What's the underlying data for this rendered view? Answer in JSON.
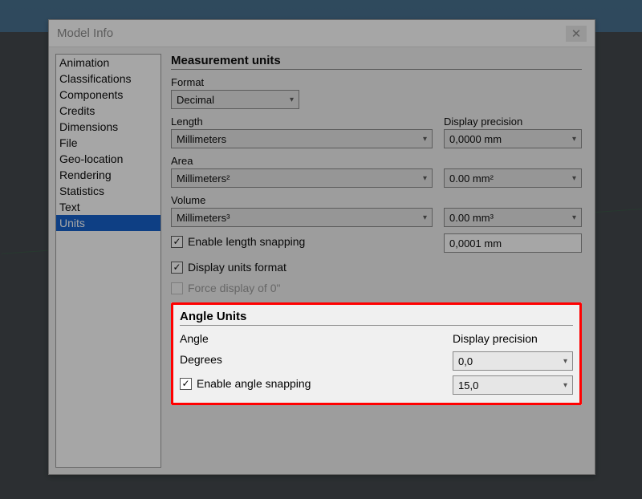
{
  "window": {
    "title": "Model Info",
    "close_icon": "✕"
  },
  "sidebar": {
    "items": [
      {
        "label": "Animation"
      },
      {
        "label": "Classifications"
      },
      {
        "label": "Components"
      },
      {
        "label": "Credits"
      },
      {
        "label": "Dimensions"
      },
      {
        "label": "File"
      },
      {
        "label": "Geo-location"
      },
      {
        "label": "Rendering"
      },
      {
        "label": "Statistics"
      },
      {
        "label": "Text"
      },
      {
        "label": "Units"
      }
    ],
    "selected_index": 10
  },
  "measurement": {
    "section_title": "Measurement units",
    "format_label": "Format",
    "format_value": "Decimal",
    "length_label": "Length",
    "length_value": "Millimeters",
    "display_precision_label": "Display precision",
    "length_precision": "0,0000 mm",
    "area_label": "Area",
    "area_value": "Millimeters²",
    "area_precision": "0.00 mm²",
    "volume_label": "Volume",
    "volume_value": "Millimeters³",
    "volume_precision": "0.00 mm³",
    "enable_length_snapping_label": "Enable length snapping",
    "enable_length_snapping_checked": true,
    "length_snapping_value": "0,0001 mm",
    "display_units_format_label": "Display units format",
    "display_units_format_checked": true,
    "force_display_label": "Force display of 0\"",
    "force_display_checked": false,
    "force_display_disabled": true
  },
  "angle": {
    "section_title": "Angle Units",
    "angle_label": "Angle",
    "display_precision_label": "Display precision",
    "angle_unit": "Degrees",
    "angle_precision": "0,0",
    "enable_snapping_label": "Enable angle snapping",
    "enable_snapping_checked": true,
    "snapping_value": "15,0"
  }
}
